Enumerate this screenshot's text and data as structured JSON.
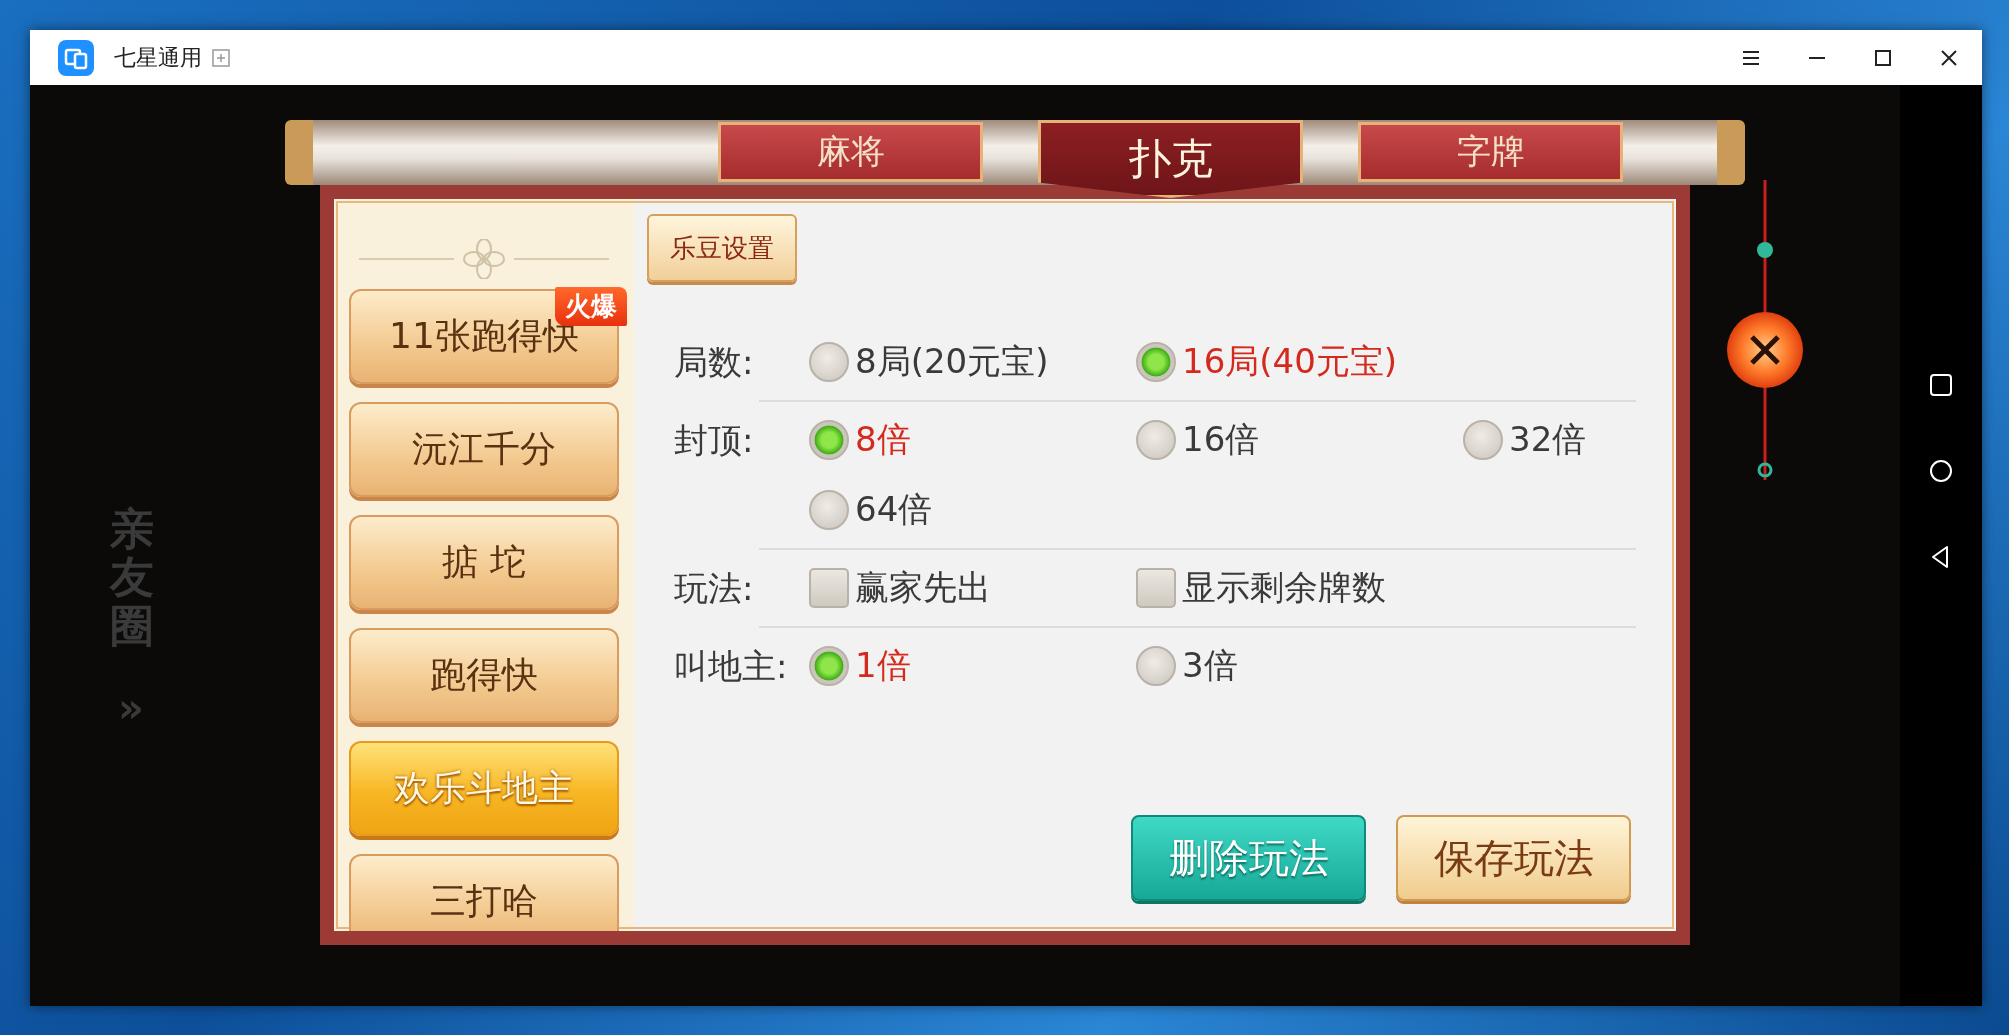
{
  "window": {
    "title": "七星通用"
  },
  "background": {
    "side_label": "亲友圈",
    "side_arrow": "»"
  },
  "category_tabs": [
    {
      "label": "麻将",
      "selected": false
    },
    {
      "label": "扑克",
      "selected": true
    },
    {
      "label": "字牌",
      "selected": false
    }
  ],
  "games": [
    {
      "label": "11张跑得快",
      "selected": false,
      "badge": "火爆"
    },
    {
      "label": "沅江千分",
      "selected": false
    },
    {
      "label": "掂 坨",
      "selected": false
    },
    {
      "label": "跑得快",
      "selected": false
    },
    {
      "label": "欢乐斗地主",
      "selected": true
    },
    {
      "label": "三打哈",
      "selected": false
    }
  ],
  "coin_settings_button": "乐豆设置",
  "options": [
    {
      "label": "局数:",
      "kind": "radio",
      "choices": [
        {
          "label": "8局(20元宝)",
          "selected": false
        },
        {
          "label": "16局(40元宝)",
          "selected": true
        }
      ]
    },
    {
      "label": "封顶:",
      "kind": "radio",
      "choices": [
        {
          "label": "8倍",
          "selected": true
        },
        {
          "label": "16倍",
          "selected": false
        },
        {
          "label": "32倍",
          "selected": false
        },
        {
          "label": "64倍",
          "selected": false
        }
      ]
    },
    {
      "label": "玩法:",
      "kind": "checkbox",
      "choices": [
        {
          "label": "赢家先出",
          "checked": false
        },
        {
          "label": "显示剩余牌数",
          "checked": false
        }
      ]
    },
    {
      "label": "叫地主:",
      "kind": "radio",
      "choices": [
        {
          "label": "1倍",
          "selected": true
        },
        {
          "label": "3倍",
          "selected": false
        }
      ]
    }
  ],
  "actions": [
    {
      "label": "删除玩法",
      "kind": "danger"
    },
    {
      "label": "保存玩法",
      "kind": "primary"
    }
  ]
}
